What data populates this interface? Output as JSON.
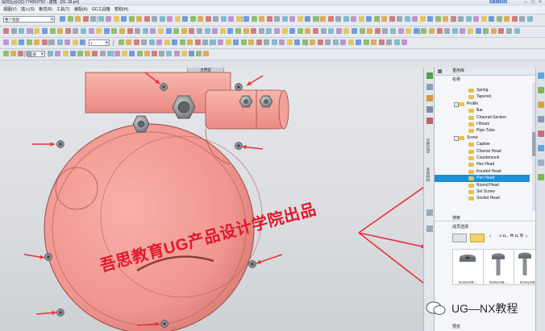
{
  "window": {
    "title": "探究后台QQ:774993752 - 建模 - [01-18.prt]",
    "brand": "SIEMENS",
    "controls": [
      "–",
      "□",
      "×"
    ]
  },
  "menubar": {
    "items": [
      "视图(V)",
      "插入(S)",
      "格式(R)",
      "工具(T)",
      "装配(A)",
      "GC工具箱",
      "帮助(H)"
    ]
  },
  "toolbar": {
    "filter_combo": "整个装配",
    "snap_combo": "1",
    "units_combo": "全部"
  },
  "viewport": {
    "tab_label": "主模型",
    "watermark": "吾思教育UG产品设计学院出品",
    "colors": {
      "part": "#f0968f",
      "part_edge": "#9a4a44",
      "arrow": "#e8323a",
      "hardware": "#8d8f92"
    }
  },
  "reuse_library": {
    "header": "重用库",
    "section_name": "名称",
    "tree": [
      {
        "label": "Spring",
        "level": 2
      },
      {
        "label": "Tapered",
        "level": 2
      },
      {
        "label": "Profile",
        "level": 1,
        "expanded": true
      },
      {
        "label": "Bar",
        "level": 2
      },
      {
        "label": "Channel-Section",
        "level": 2
      },
      {
        "label": "I-Beam",
        "level": 2
      },
      {
        "label": "Pipe-Tube",
        "level": 2
      },
      {
        "label": "Screw",
        "level": 1,
        "expanded": true
      },
      {
        "label": "Captive",
        "level": 2
      },
      {
        "label": "Cheese Head",
        "level": 2
      },
      {
        "label": "Countersunk",
        "level": 2
      },
      {
        "label": "Hex Head",
        "level": 2
      },
      {
        "label": "Knurled Head",
        "level": 2
      },
      {
        "label": "Pan Head",
        "level": 2,
        "selected": true
      },
      {
        "label": "Round Head",
        "level": 2
      },
      {
        "label": "Set Screw",
        "level": 2
      },
      {
        "label": "Socket Head",
        "level": 2
      }
    ],
    "search_label": "搜索",
    "member_select_label": "成员选择",
    "pager": "1-11，共 11 项",
    "members": [
      {
        "caption": "Screw,GB-..."
      },
      {
        "caption": "Screw,GB-..."
      },
      {
        "caption": "Screw,GB-..."
      }
    ],
    "preview_label": "预览"
  },
  "side_tabs": {
    "history": "历史记录",
    "system": "系统材料"
  },
  "corner_watermark": {
    "text": "UG—NX教程",
    "icon": "wechat-icon"
  }
}
